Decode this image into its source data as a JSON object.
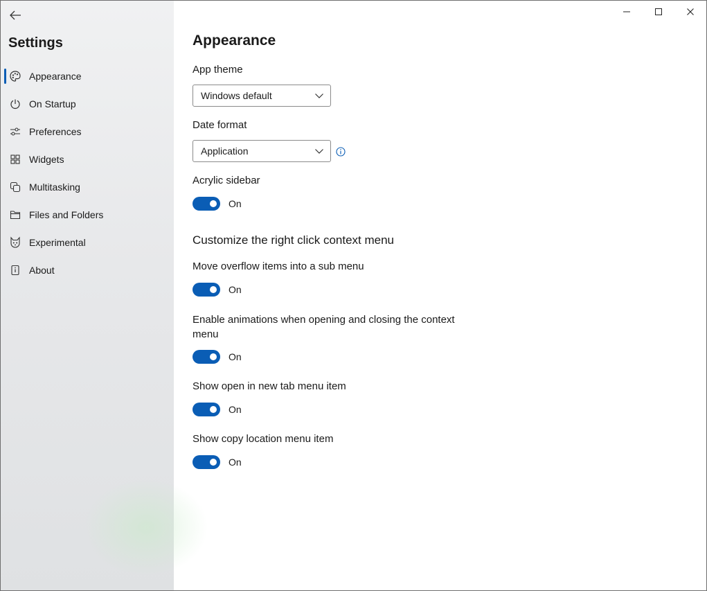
{
  "sidebar": {
    "title": "Settings",
    "items": [
      {
        "label": "Appearance",
        "icon": "palette-icon",
        "selected": true
      },
      {
        "label": "On Startup",
        "icon": "power-icon",
        "selected": false
      },
      {
        "label": "Preferences",
        "icon": "sliders-icon",
        "selected": false
      },
      {
        "label": "Widgets",
        "icon": "widgets-icon",
        "selected": false
      },
      {
        "label": "Multitasking",
        "icon": "multitasking-icon",
        "selected": false
      },
      {
        "label": "Files and Folders",
        "icon": "folder-icon",
        "selected": false
      },
      {
        "label": "Experimental",
        "icon": "cat-icon",
        "selected": false
      },
      {
        "label": "About",
        "icon": "about-icon",
        "selected": false
      }
    ]
  },
  "main": {
    "title": "Appearance",
    "app_theme": {
      "label": "App theme",
      "value": "Windows default"
    },
    "date_format": {
      "label": "Date format",
      "value": "Application"
    },
    "acrylic_sidebar": {
      "label": "Acrylic sidebar",
      "state": "On"
    },
    "context_menu": {
      "header": "Customize the right click context menu",
      "overflow": {
        "label": "Move overflow items into a sub menu",
        "state": "On"
      },
      "animations": {
        "label": "Enable animations when opening and closing the context menu",
        "state": "On"
      },
      "open_new_tab": {
        "label": "Show open in new tab menu item",
        "state": "On"
      },
      "copy_location": {
        "label": "Show copy location menu item",
        "state": "On"
      }
    }
  },
  "colors": {
    "accent": "#0a5db5",
    "sidebar_bg": "#e7e8ea",
    "content_bg": "#ffffff"
  }
}
